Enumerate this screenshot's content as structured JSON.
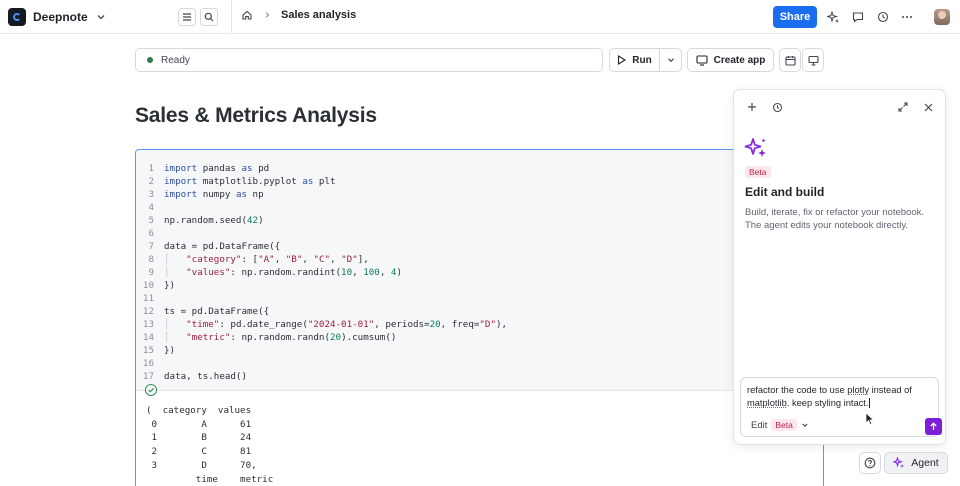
{
  "app": {
    "workspace_name": "Deepnote",
    "breadcrumb_title": "Sales analysis",
    "share_label": "Share"
  },
  "toolbar": {
    "status_text": "Ready",
    "run_label": "Run",
    "create_app_label": "Create app"
  },
  "notebook": {
    "title": "Sales & Metrics Analysis",
    "code_lines": [
      {
        "n": "1",
        "tokens": [
          [
            "kw",
            "import"
          ],
          [
            "tx",
            " pandas "
          ],
          [
            "kw",
            "as"
          ],
          [
            "tx",
            " pd"
          ]
        ]
      },
      {
        "n": "2",
        "tokens": [
          [
            "kw",
            "import"
          ],
          [
            "tx",
            " matplotlib.pyplot "
          ],
          [
            "kw",
            "as"
          ],
          [
            "tx",
            " plt"
          ]
        ]
      },
      {
        "n": "3",
        "tokens": [
          [
            "kw",
            "import"
          ],
          [
            "tx",
            " numpy "
          ],
          [
            "kw",
            "as"
          ],
          [
            "tx",
            " np"
          ]
        ]
      },
      {
        "n": "4",
        "tokens": []
      },
      {
        "n": "5",
        "tokens": [
          [
            "tx",
            "np.random.seed("
          ],
          [
            "num",
            "42"
          ],
          [
            "tx",
            ")"
          ]
        ]
      },
      {
        "n": "6",
        "tokens": []
      },
      {
        "n": "7",
        "tokens": [
          [
            "tx",
            "data = pd.DataFrame({"
          ]
        ]
      },
      {
        "n": "8",
        "tokens": [
          [
            "gutter",
            "│   "
          ],
          [
            "str",
            "\"category\""
          ],
          [
            "tx",
            ": ["
          ],
          [
            "str",
            "\"A\""
          ],
          [
            "tx",
            ", "
          ],
          [
            "str",
            "\"B\""
          ],
          [
            "tx",
            ", "
          ],
          [
            "str",
            "\"C\""
          ],
          [
            "tx",
            ", "
          ],
          [
            "str",
            "\"D\""
          ],
          [
            "tx",
            "],"
          ]
        ]
      },
      {
        "n": "9",
        "tokens": [
          [
            "gutter",
            "│   "
          ],
          [
            "str",
            "\"values\""
          ],
          [
            "tx",
            ": np.random.randint("
          ],
          [
            "num",
            "10"
          ],
          [
            "tx",
            ", "
          ],
          [
            "num",
            "100"
          ],
          [
            "tx",
            ", "
          ],
          [
            "num",
            "4"
          ],
          [
            "tx",
            ")"
          ]
        ]
      },
      {
        "n": "10",
        "tokens": [
          [
            "tx",
            "})"
          ]
        ]
      },
      {
        "n": "11",
        "tokens": []
      },
      {
        "n": "12",
        "tokens": [
          [
            "tx",
            "ts = pd.DataFrame({"
          ]
        ]
      },
      {
        "n": "13",
        "tokens": [
          [
            "gutter",
            "│   "
          ],
          [
            "str",
            "\"time\""
          ],
          [
            "tx",
            ": pd.date_range("
          ],
          [
            "str",
            "\"2024-01-01\""
          ],
          [
            "tx",
            ", periods="
          ],
          [
            "num",
            "20"
          ],
          [
            "tx",
            ", freq="
          ],
          [
            "str",
            "\"D\""
          ],
          [
            "tx",
            "),"
          ]
        ]
      },
      {
        "n": "14",
        "tokens": [
          [
            "gutter",
            "│   "
          ],
          [
            "str",
            "\"metric\""
          ],
          [
            "tx",
            ": np.random.randn("
          ],
          [
            "num",
            "20"
          ],
          [
            "tx",
            ").cumsum()"
          ]
        ]
      },
      {
        "n": "15",
        "tokens": [
          [
            "tx",
            "})"
          ]
        ]
      },
      {
        "n": "16",
        "tokens": []
      },
      {
        "n": "17",
        "tokens": [
          [
            "tx",
            "data, ts.head()"
          ]
        ]
      }
    ],
    "output_lines": [
      "(  category  values",
      " 0        A      61",
      " 1        B      24",
      " 2        C      81",
      " 3        D      70,",
      "         time    metric"
    ]
  },
  "agent": {
    "badge": "Beta",
    "title": "Edit and build",
    "description": "Build, iterate, fix or refactor your notebook. The agent edits your notebook directly.",
    "prompt_part1": "refactor the code to use ",
    "prompt_word1": "plotly",
    "prompt_part2": " instead of ",
    "prompt_word2": "matplotlib",
    "prompt_part3": ". keep styling intact.",
    "mode_label": "Edit",
    "mode_badge": "Beta",
    "button_label": "Agent"
  },
  "colors": {
    "share": "#1a6cf0",
    "send": "#7d1fd6",
    "cell_border": "#5a98f2",
    "beta_text": "#c02048"
  },
  "icons": [
    "workspace-logo-icon",
    "chevron-down-icon",
    "menu-icon",
    "search-icon",
    "home-icon",
    "chevron-right-icon",
    "sparkle-icon",
    "comment-icon",
    "history-icon",
    "more-icon",
    "play-icon",
    "monitor-icon",
    "calendar-icon",
    "present-icon",
    "plus-icon",
    "expand-icon",
    "close-icon",
    "check-circle-icon",
    "send-arrow-icon",
    "help-icon"
  ]
}
